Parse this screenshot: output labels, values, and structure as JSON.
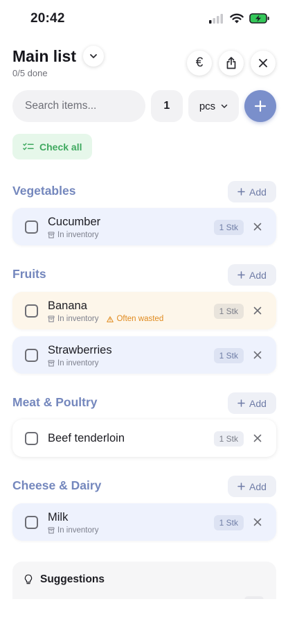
{
  "status": {
    "time": "20:42"
  },
  "header": {
    "title": "Main list",
    "progress": "0/5 done",
    "currency_symbol": "€"
  },
  "add_bar": {
    "search_placeholder": "Search items...",
    "quantity": "1",
    "unit": "pcs"
  },
  "check_all_label": "Check all",
  "sections": [
    {
      "title": "Vegetables",
      "add_label": "Add",
      "items": [
        {
          "name": "Cucumber",
          "quantity": "1 Stk",
          "inventory": "In inventory"
        }
      ]
    },
    {
      "title": "Fruits",
      "add_label": "Add",
      "items": [
        {
          "name": "Banana",
          "quantity": "1 Stk",
          "inventory": "In inventory",
          "warning": "Often wasted"
        },
        {
          "name": "Strawberries",
          "quantity": "1 Stk",
          "inventory": "In inventory"
        }
      ]
    },
    {
      "title": "Meat & Poultry",
      "add_label": "Add",
      "items": [
        {
          "name": "Beef tenderloin",
          "quantity": "1 Stk"
        }
      ]
    },
    {
      "title": "Cheese & Dairy",
      "add_label": "Add",
      "items": [
        {
          "name": "Milk",
          "quantity": "1 Stk",
          "inventory": "In inventory"
        }
      ]
    }
  ],
  "suggestions": {
    "title": "Suggestions"
  },
  "colors": {
    "accent": "#7a8fcb",
    "section_title": "#7487bd",
    "check_all_green": "#3fa95f",
    "warning_orange": "#e08a1e",
    "battery_green": "#34c759"
  },
  "icons": {
    "status": [
      "cellular-signal-icon",
      "wifi-icon",
      "battery-charging-icon"
    ],
    "header": [
      "chevron-down-icon",
      "euro-icon",
      "share-icon",
      "close-icon"
    ],
    "items": [
      "checkbox-icon",
      "archive-box-icon",
      "warning-triangle-icon",
      "remove-x-icon"
    ]
  }
}
